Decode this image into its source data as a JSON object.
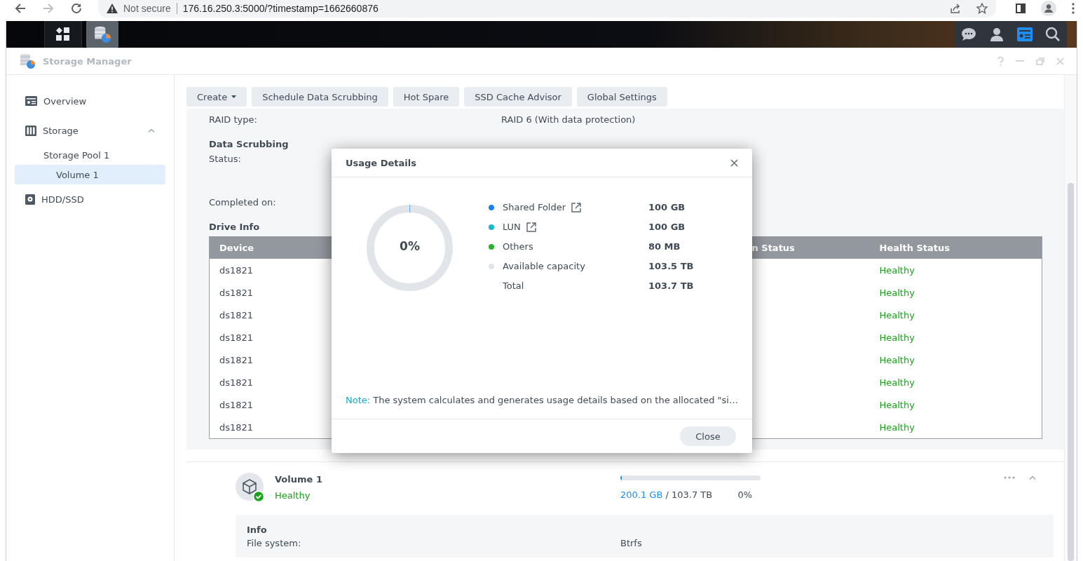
{
  "browser": {
    "security_label": "Not secure",
    "url": "176.16.250.3:5000/?timestamp=1662660876"
  },
  "taskbar": {
    "apps": [
      {
        "kind": "main_menu",
        "active": false
      },
      {
        "kind": "storage_manager",
        "active": true
      }
    ],
    "tray": [
      {
        "kind": "chat",
        "active": false
      },
      {
        "kind": "user",
        "active": false
      },
      {
        "kind": "widgets",
        "active": true
      },
      {
        "kind": "search",
        "active": false
      }
    ]
  },
  "window": {
    "title": "Storage Manager"
  },
  "sidebar": {
    "items": [
      {
        "label": "Overview",
        "kind": "overview",
        "selected": false
      },
      {
        "label": "Storage",
        "kind": "storage",
        "selected": false,
        "expanded": true,
        "children": [
          {
            "label": "Storage Pool 1",
            "selected": false,
            "children": [
              {
                "label": "Volume 1",
                "selected": true
              }
            ]
          }
        ]
      },
      {
        "label": "HDD/SSD",
        "kind": "hdd",
        "selected": false
      }
    ]
  },
  "toolbar": {
    "buttons": [
      {
        "label": "Create",
        "kind": "dropdown"
      },
      {
        "label": "Schedule Data Scrubbing",
        "kind": "plain"
      },
      {
        "label": "Hot Spare",
        "kind": "plain"
      },
      {
        "label": "SSD Cache Advisor",
        "kind": "plain"
      },
      {
        "label": "Global Settings",
        "kind": "plain"
      }
    ]
  },
  "pool_details": {
    "raid_type": {
      "label": "RAID type:",
      "value": "RAID 6 (With data protection)"
    },
    "data_scrubbing": {
      "title": "Data Scrubbing",
      "fields": [
        {
          "label": "Status:"
        },
        {
          "label": "Completed on:"
        }
      ]
    },
    "drive_info": {
      "title": "Drive Info",
      "columns": [
        "Device",
        "n Status",
        "Health Status"
      ],
      "rows": [
        {
          "device": "ds1821",
          "health": "Healthy"
        },
        {
          "device": "ds1821",
          "health": "Healthy"
        },
        {
          "device": "ds1821",
          "health": "Healthy"
        },
        {
          "device": "ds1821",
          "health": "Healthy"
        },
        {
          "device": "ds1821",
          "health": "Healthy"
        },
        {
          "device": "ds1821",
          "health": "Healthy"
        },
        {
          "device": "ds1821",
          "health": "Healthy"
        },
        {
          "device": "ds1821",
          "health": "Healthy"
        }
      ]
    }
  },
  "volume": {
    "name": "Volume 1",
    "status": "Healthy",
    "level": 0.01,
    "used": "200.1 GB",
    "total": "/ 103.7 TB",
    "percent": "0%",
    "expanded": true,
    "info": {
      "title": "Info",
      "fields": [
        {
          "label": "File system:",
          "value": "Btrfs"
        }
      ]
    }
  },
  "dialog": {
    "title": "Usage Details",
    "percent": "0%",
    "legend": [
      {
        "kind": "category",
        "label": "Shared Folder",
        "link": true,
        "color": "#1a82f0",
        "value": "100 GB"
      },
      {
        "kind": "category",
        "label": "LUN",
        "link": true,
        "color": "#19b9cf",
        "value": "100 GB"
      },
      {
        "kind": "category",
        "label": "Others",
        "link": false,
        "color": "#2bb12b",
        "value": "80 MB"
      },
      {
        "kind": "category",
        "label": "Available capacity",
        "link": false,
        "color": "#e1e5ea",
        "value": "103.5 TB"
      },
      {
        "kind": "total",
        "label": "Total",
        "value": "103.7 TB"
      }
    ],
    "note_label": "Note:",
    "note": "The system calculates and generates usage details based on the allocated \"si…",
    "buttons": [
      "Close"
    ]
  }
}
